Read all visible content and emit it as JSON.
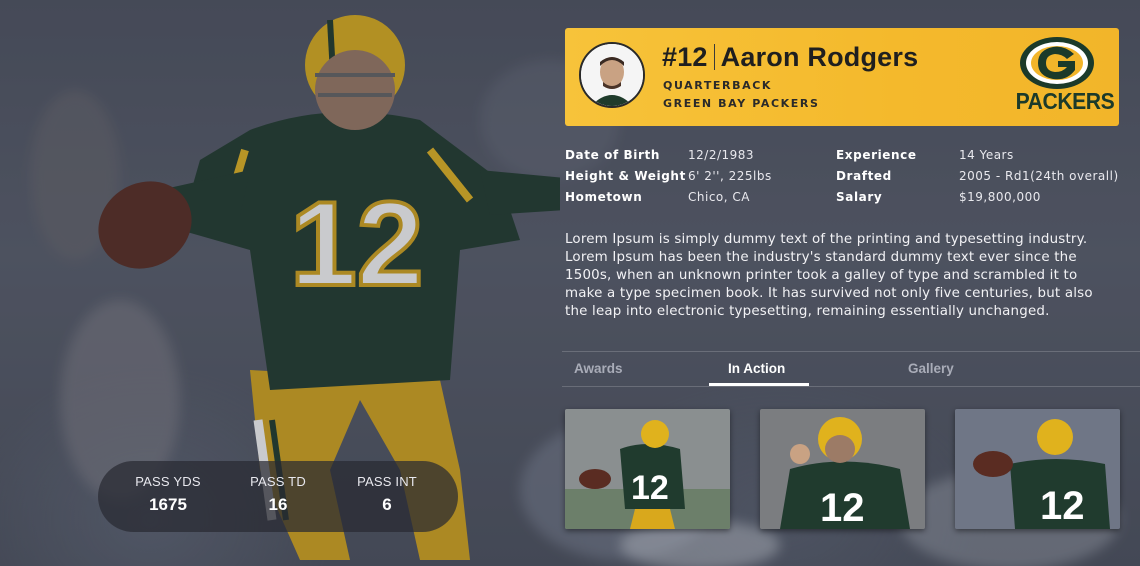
{
  "colors": {
    "header_gold": "#f4b92c",
    "packers_green": "#203731",
    "packers_gold": "#ffb612"
  },
  "player": {
    "number": "#12",
    "name": "Aaron Rodgers",
    "position": "QUARTERBACK",
    "team": "GREEN BAY PACKERS",
    "logo_text": "PACKERS"
  },
  "bio": {
    "left": [
      {
        "label": "Date of Birth",
        "value": "12/2/1983"
      },
      {
        "label": "Height & Weight",
        "value": "6' 2'', 225lbs"
      },
      {
        "label": "Hometown",
        "value": "Chico, CA"
      }
    ],
    "right": [
      {
        "label": "Experience",
        "value": "14 Years"
      },
      {
        "label": "Drafted",
        "value": "2005 - Rd1(24th overall)"
      },
      {
        "label": "Salary",
        "value": "$19,800,000"
      }
    ]
  },
  "description": "Lorem Ipsum is simply dummy text of the printing and typesetting industry. Lorem Ipsum has been the industry's standard dummy text ever since the 1500s, when an unknown printer took a galley of type and scrambled it to make a type specimen book. It has survived not only five centuries, but also the leap into electronic typesetting, remaining essentially unchanged.",
  "tabs": [
    {
      "label": "Awards",
      "active": false
    },
    {
      "label": "In Action",
      "active": true
    },
    {
      "label": "Gallery",
      "active": false
    }
  ],
  "stats": [
    {
      "label": "PASS YDS",
      "value": "1675"
    },
    {
      "label": "PASS TD",
      "value": "16"
    },
    {
      "label": "PASS INT",
      "value": "6"
    }
  ],
  "gallery": [
    {
      "icon": "action-photo-1"
    },
    {
      "icon": "action-photo-2"
    },
    {
      "icon": "action-photo-3"
    }
  ]
}
